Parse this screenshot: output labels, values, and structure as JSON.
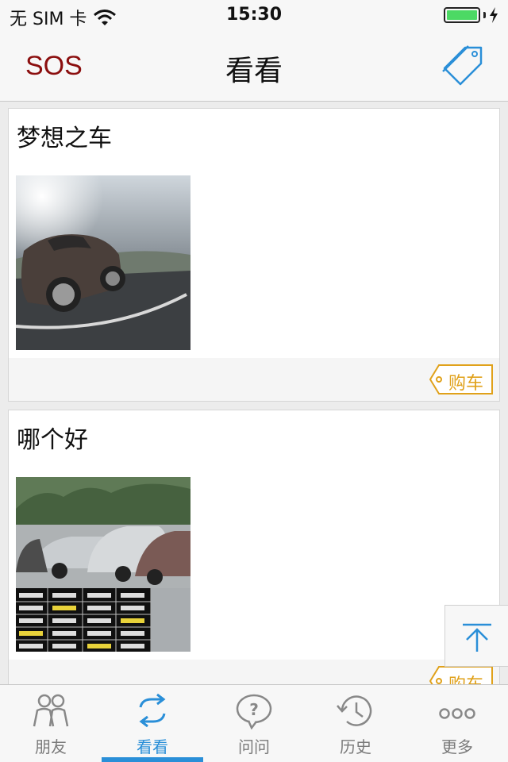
{
  "status_bar": {
    "carrier": "无 SIM 卡",
    "time": "15:30",
    "battery_level": 1.0
  },
  "nav": {
    "left_label": "SOS",
    "title": "看看",
    "right_icon": "tag-icon"
  },
  "feed": [
    {
      "title": "梦想之车",
      "tag_label": "购车",
      "image": "sports-car-photo"
    },
    {
      "title": "哪个好",
      "tag_label": "购车",
      "image": "cars-price-table-photo"
    }
  ],
  "scroll_top": {
    "icon": "arrow-up-to-top-icon"
  },
  "tabs": [
    {
      "label": "朋友",
      "icon": "friends-icon",
      "active": false
    },
    {
      "label": "看看",
      "icon": "exchange-arrows-icon",
      "active": true
    },
    {
      "label": "问问",
      "icon": "question-bubble-icon",
      "active": false
    },
    {
      "label": "历史",
      "icon": "history-clock-icon",
      "active": false
    },
    {
      "label": "更多",
      "icon": "more-dots-icon",
      "active": false
    }
  ],
  "colors": {
    "accent": "#2a8fd8",
    "sos": "#8b0e0e",
    "tag": "#e0a11a"
  }
}
